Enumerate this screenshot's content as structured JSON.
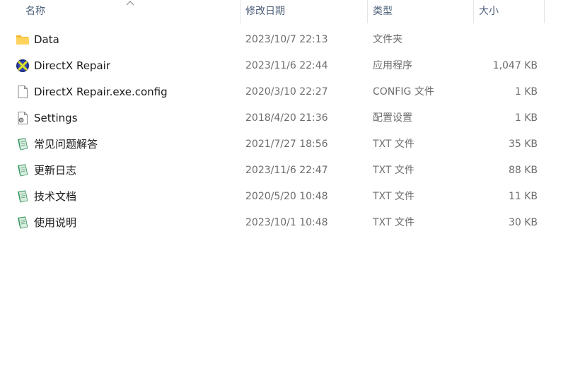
{
  "header": {
    "name": "名称",
    "date": "修改日期",
    "type": "类型",
    "size": "大小"
  },
  "files": [
    {
      "name": "Data",
      "date": "2023/10/7 22:13",
      "type": "文件夹",
      "size": "",
      "icon": "folder-icon"
    },
    {
      "name": "DirectX Repair",
      "date": "2023/11/6 22:44",
      "type": "应用程序",
      "size": "1,047 KB",
      "icon": "app-icon"
    },
    {
      "name": "DirectX Repair.exe.config",
      "date": "2020/3/10 22:27",
      "type": "CONFIG 文件",
      "size": "1 KB",
      "icon": "file-icon"
    },
    {
      "name": "Settings",
      "date": "2018/4/20 21:36",
      "type": "配置设置",
      "size": "1 KB",
      "icon": "settings-file-icon"
    },
    {
      "name": "常见问题解答",
      "date": "2021/7/27 18:56",
      "type": "TXT 文件",
      "size": "35 KB",
      "icon": "text-file-icon"
    },
    {
      "name": "更新日志",
      "date": "2023/11/6 22:47",
      "type": "TXT 文件",
      "size": "88 KB",
      "icon": "text-file-icon"
    },
    {
      "name": "技术文档",
      "date": "2020/5/20 10:48",
      "type": "TXT 文件",
      "size": "11 KB",
      "icon": "text-file-icon"
    },
    {
      "name": "使用说明",
      "date": "2023/10/1 10:48",
      "type": "TXT 文件",
      "size": "30 KB",
      "icon": "text-file-icon"
    }
  ]
}
